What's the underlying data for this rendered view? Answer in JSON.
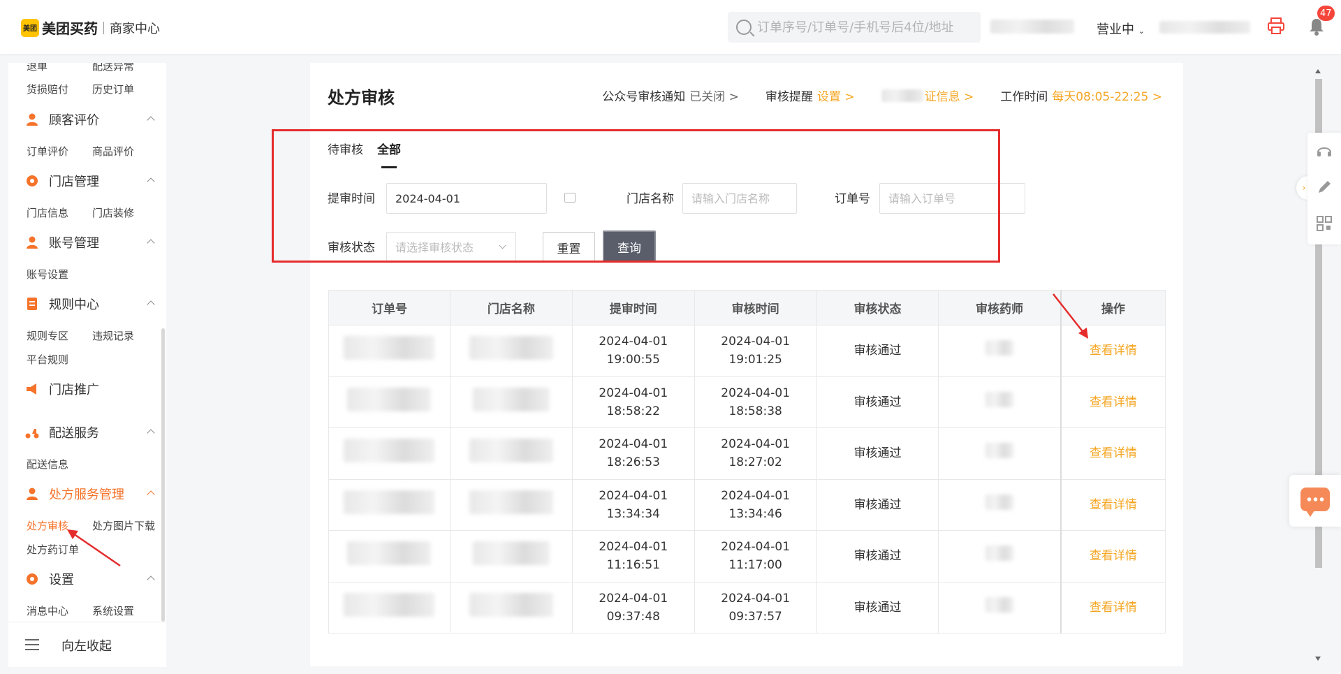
{
  "header": {
    "logo_mark": "美团",
    "logo_text": "美团买药",
    "logo_sub": "商家中心",
    "search_placeholder": "订单序号/订单号/手机号后4位/地址",
    "status": "营业中",
    "badge_count": "47"
  },
  "sidebar": {
    "top_subs": [
      "退单",
      "配送异常",
      "货损赔付",
      "历史订单"
    ],
    "sections": [
      {
        "label": "顾客评价",
        "subs": [
          "订单评价",
          "商品评价"
        ]
      },
      {
        "label": "门店管理",
        "subs": [
          "门店信息",
          "门店装修"
        ]
      },
      {
        "label": "账号管理",
        "subs": [
          "账号设置"
        ]
      },
      {
        "label": "规则中心",
        "subs": [
          "规则专区",
          "违规记录",
          "平台规则"
        ]
      },
      {
        "label": "门店推广",
        "subs": []
      },
      {
        "label": "配送服务",
        "subs": [
          "配送信息"
        ]
      },
      {
        "label": "处方服务管理",
        "subs": [
          "处方审核",
          "处方图片下载",
          "处方药订单"
        ]
      },
      {
        "label": "设置",
        "subs": [
          "消息中心",
          "系统设置"
        ]
      }
    ],
    "collapse_label": "向左收起"
  },
  "main": {
    "title": "处方审核",
    "topinfo": {
      "notify_label": "公众号审核通知",
      "notify_value": "已关闭 >",
      "reminder_label": "审核提醒",
      "reminder_value": "设置 >",
      "cert_value": "证信息 >",
      "worktime_label": "工作时间",
      "worktime_value": "每天08:05-22:25 >"
    },
    "tabs": [
      "待审核",
      "全部"
    ],
    "filters": {
      "submit_time_label": "提审时间",
      "submit_time_value": "2024-04-01",
      "store_label": "门店名称",
      "store_placeholder": "请输入门店名称",
      "order_label": "订单号",
      "order_placeholder": "请输入订单号",
      "status_label": "审核状态",
      "status_placeholder": "请选择审核状态",
      "reset_label": "重置",
      "query_label": "查询"
    },
    "table": {
      "headers": [
        "订单号",
        "门店名称",
        "提审时间",
        "审核时间",
        "审核状态",
        "审核药师",
        "操作"
      ],
      "rows": [
        {
          "submit": "2024-04-01 19:00:55",
          "review": "2024-04-01 19:01:25",
          "status": "审核通过",
          "action": "查看详情"
        },
        {
          "submit": "2024-04-01 18:58:22",
          "review": "2024-04-01 18:58:38",
          "status": "审核通过",
          "action": "查看详情"
        },
        {
          "submit": "2024-04-01 18:26:53",
          "review": "2024-04-01 18:27:02",
          "status": "审核通过",
          "action": "查看详情"
        },
        {
          "submit": "2024-04-01 13:34:34",
          "review": "2024-04-01 13:34:46",
          "status": "审核通过",
          "action": "查看详情"
        },
        {
          "submit": "2024-04-01 11:16:51",
          "review": "2024-04-01 11:17:00",
          "status": "审核通过",
          "action": "查看详情"
        },
        {
          "submit": "2024-04-01 09:37:48",
          "review": "2024-04-01 09:37:57",
          "status": "审核通过",
          "action": "查看详情"
        }
      ]
    }
  },
  "colors": {
    "accent": "#f5732a",
    "link": "#f5a623",
    "highlight": "#e52c2c"
  }
}
